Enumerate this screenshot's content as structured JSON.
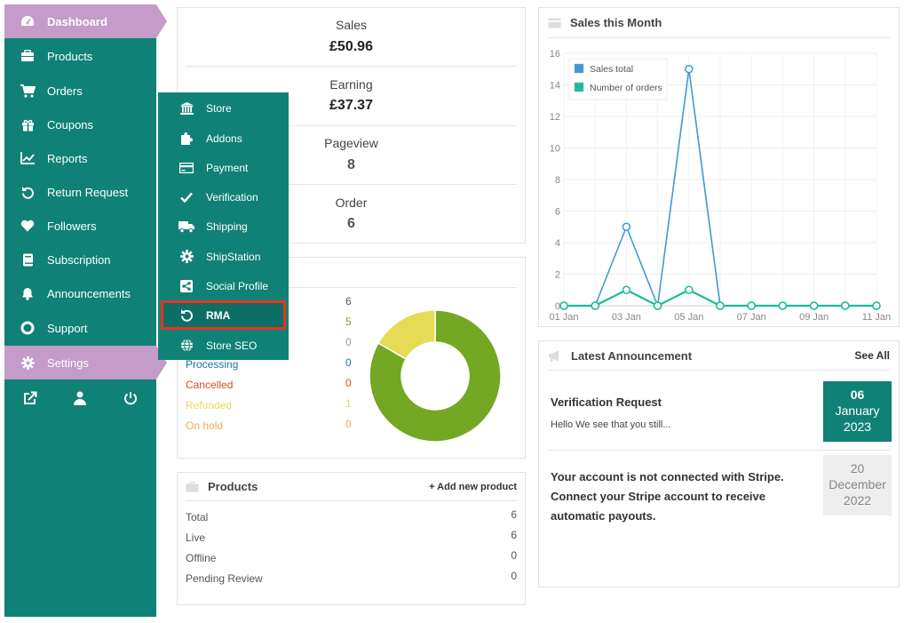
{
  "sidebar": {
    "items": [
      {
        "label": "Dashboard",
        "icon": "dashboard-icon"
      },
      {
        "label": "Products",
        "icon": "briefcase-icon"
      },
      {
        "label": "Orders",
        "icon": "cart-icon"
      },
      {
        "label": "Coupons",
        "icon": "gift-icon"
      },
      {
        "label": "Reports",
        "icon": "chart-icon"
      },
      {
        "label": "Return Request",
        "icon": "undo-icon"
      },
      {
        "label": "Followers",
        "icon": "heart-icon"
      },
      {
        "label": "Subscription",
        "icon": "book-icon"
      },
      {
        "label": "Announcements",
        "icon": "bell-icon"
      },
      {
        "label": "Support",
        "icon": "lifebuoy-icon"
      },
      {
        "label": "Settings",
        "icon": "gear-icon"
      }
    ]
  },
  "submenu": {
    "items": [
      {
        "label": "Store",
        "icon": "bank-icon"
      },
      {
        "label": "Addons",
        "icon": "puzzle-icon"
      },
      {
        "label": "Payment",
        "icon": "credit-card-icon"
      },
      {
        "label": "Verification",
        "icon": "check-icon"
      },
      {
        "label": "Shipping",
        "icon": "truck-icon"
      },
      {
        "label": "ShipStation",
        "icon": "gear-icon"
      },
      {
        "label": "Social Profile",
        "icon": "share-icon"
      },
      {
        "label": "RMA",
        "icon": "undo-icon"
      },
      {
        "label": "Store SEO",
        "icon": "globe-icon"
      }
    ]
  },
  "stats": {
    "sales_label": "Sales",
    "sales_value": "£50.96",
    "earning_label": "Earning",
    "earning_value": "£37.37",
    "pageview_label": "Pageview",
    "pageview_value": "8",
    "order_label": "Order",
    "order_value": "6"
  },
  "orders": {
    "rows": [
      {
        "label": "",
        "count": "6",
        "color": "#555555"
      },
      {
        "label": "",
        "count": "5",
        "color": "#73a724"
      },
      {
        "label": "",
        "count": "0",
        "color": "#999999"
      },
      {
        "label": "Processing",
        "count": "0",
        "color": "#21759b"
      },
      {
        "label": "Cancelled",
        "count": "0",
        "color": "#d54e21"
      },
      {
        "label": "Refunded",
        "count": "1",
        "color": "#e6db55"
      },
      {
        "label": "On hold",
        "count": "0",
        "color": "#f0ad4e"
      }
    ],
    "donut": [
      {
        "value": 5,
        "color": "#73a724"
      },
      {
        "value": 1,
        "color": "#e6db55"
      }
    ]
  },
  "products": {
    "title": "Products",
    "add_link": "+ Add new product",
    "rows": [
      {
        "label": "Total",
        "value": "6"
      },
      {
        "label": "Live",
        "value": "6"
      },
      {
        "label": "Offline",
        "value": "0"
      },
      {
        "label": "Pending Review",
        "value": "0"
      }
    ]
  },
  "sales_chart": {
    "title": "Sales this Month"
  },
  "chart_data": {
    "type": "line",
    "x": [
      "01 Jan",
      "02 Jan",
      "03 Jan",
      "04 Jan",
      "05 Jan",
      "06 Jan",
      "07 Jan",
      "08 Jan",
      "09 Jan",
      "10 Jan",
      "11 Jan"
    ],
    "xticks": [
      "01 Jan",
      "03 Jan",
      "05 Jan",
      "07 Jan",
      "09 Jan",
      "11 Jan"
    ],
    "series": [
      {
        "name": "Sales total",
        "color": "#3e9ad6",
        "values": [
          0,
          0,
          5,
          0,
          15,
          0,
          0,
          0,
          0,
          0,
          0
        ]
      },
      {
        "name": "Number of orders",
        "color": "#1bbc9b",
        "values": [
          0,
          0,
          1,
          0,
          1,
          0,
          0,
          0,
          0,
          0,
          0
        ]
      }
    ],
    "ylim": [
      0,
      16
    ],
    "yticks": [
      0,
      2,
      4,
      6,
      8,
      10,
      12,
      14,
      16
    ],
    "legend": "top-left",
    "grid": true
  },
  "announcements": {
    "title": "Latest Announcement",
    "see_all": "See All",
    "items": [
      {
        "title": "Verification Request",
        "excerpt": "Hello  We see that you still...",
        "day": "06",
        "month": "January",
        "year": "2023"
      },
      {
        "title": "Your account is not connected with Stripe. Connect your Stripe account to receive automatic payouts.",
        "excerpt": "",
        "day": "20",
        "month": "December",
        "year": "2022"
      }
    ]
  }
}
